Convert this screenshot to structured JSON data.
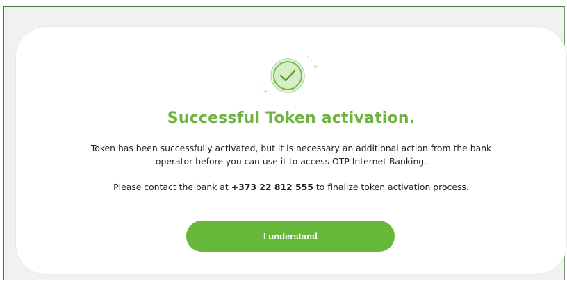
{
  "dialog": {
    "title": "Successful Token activation.",
    "message_line1": "Token has been successfully activated, but it is necessary an additional action from the bank",
    "message_line2": "operator before you can use it to access OTP Internet Banking.",
    "contact_prefix": "Please contact the bank at ",
    "contact_phone": "+373 22 812 555",
    "contact_suffix": " to finalize token activation process.",
    "confirm_label": "I understand",
    "icon": "success-checkmark-icon",
    "colors": {
      "accent": "#6db33f",
      "button": "#66b83a",
      "icon_fill": "#d8efc7",
      "frame_border": "#3f7d3a"
    }
  }
}
